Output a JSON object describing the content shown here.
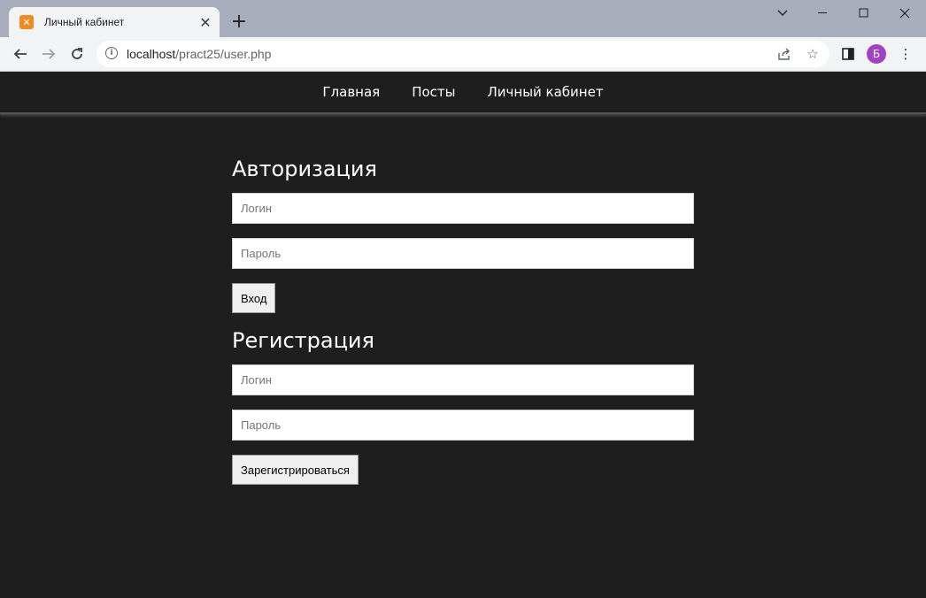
{
  "browser": {
    "tab_title": "Личный кабинет",
    "favicon_glyph": "✕",
    "url_host": "localhost",
    "url_path": "/pract25/user.php",
    "profile_initial": "Б",
    "colors": {
      "tabstrip": "#a7adbb",
      "avatar": "#a142c2",
      "favicon": "#f08a24"
    }
  },
  "nav": {
    "items": [
      {
        "label": "Главная"
      },
      {
        "label": "Посты"
      },
      {
        "label": "Личный кабинет"
      }
    ]
  },
  "login": {
    "heading": "Авторизация",
    "login_placeholder": "Логин",
    "password_placeholder": "Пароль",
    "submit_label": "Вход"
  },
  "register": {
    "heading": "Регистрация",
    "login_placeholder": "Логин",
    "password_placeholder": "Пароль",
    "submit_label": "Зарегистрироваться"
  }
}
